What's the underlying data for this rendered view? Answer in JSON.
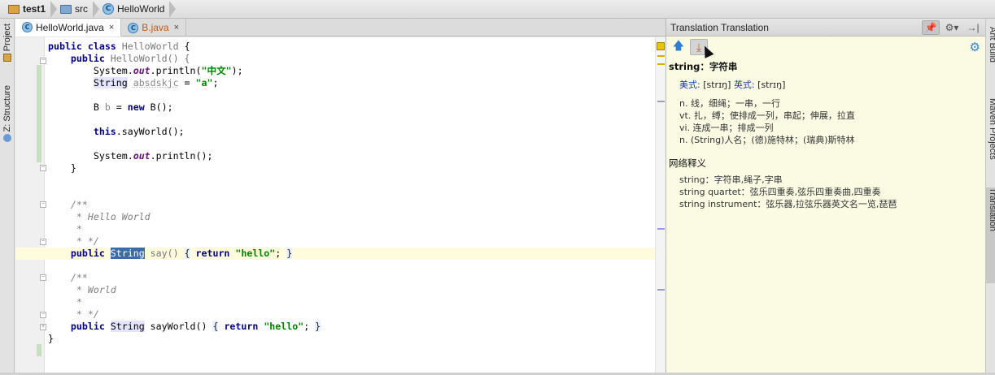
{
  "breadcrumb": {
    "project": "test1",
    "folder": "src",
    "file": "HelloWorld"
  },
  "left_tools": {
    "project": "1: Project",
    "structure": "Z: Structure",
    "project_short": "Project"
  },
  "tabs": [
    {
      "label": "HelloWorld.java",
      "close": "×"
    },
    {
      "label": "B.java",
      "close": "×"
    }
  ],
  "code": {
    "l1": [
      "public",
      "class",
      "HelloWorld",
      "{"
    ],
    "l2_kw": "public",
    "l2_name": "HelloWorld() {",
    "l3_a": "System.",
    "l3_b": "out",
    "l3_c": ".println(",
    "l3_d": "\"中文\"",
    "l3_e": ");",
    "l4_a": "String",
    "l4_b": "absdskjc",
    "l4_c": " = ",
    "l4_d": "\"a\"",
    "l4_e": ";",
    "l6_a": "B ",
    "l6_b": "b",
    "l6_c": " = ",
    "l6_d": "new",
    "l6_e": " B();",
    "l8_a": "this",
    "l8_b": ".sayWorld();",
    "l10_a": "System.",
    "l10_b": "out",
    "l10_c": ".println();",
    "l11": "}",
    "c1": "/**",
    "c2": " * Hello World",
    "c3": " *",
    "c4": " * */",
    "say_kw": "public",
    "say_type": "String",
    "say_name": "say()",
    "say_open": "{",
    "say_ret": "return",
    "say_str": "\"hello\"",
    "say_end": ";",
    "say_close": "}",
    "c5": "/**",
    "c6": " * World",
    "c7": " *",
    "c8": " * */",
    "sw_kw": "public",
    "sw_type": "String",
    "sw_name": "sayWorld()",
    "sw_open": "{",
    "sw_ret": "return",
    "sw_str": "\"hello\"",
    "sw_end": ";",
    "sw_close": "}",
    "last": "}"
  },
  "panel": {
    "title": "Translation Translation",
    "word": "string",
    "word_sep": "：",
    "word_zh": "字符串",
    "phon_us_label": "美式:",
    "phon_us": "[strɪŋ]",
    "phon_uk_label": "英式:",
    "phon_uk": "[strɪŋ]",
    "defs": [
      "n. 线，细绳；一串，一行",
      "vt. 扎，缚；使排成一列，串起；伸展，拉直",
      "vi. 连成一串；排成一列",
      "n. (String)人名；(德)施特林；(瑞典)斯特林"
    ],
    "net_title": "网络释义",
    "net": [
      "string：字符串,绳子,字串",
      "string quartet：弦乐四重奏,弦乐四重奏曲,四重奏",
      "string instrument：弦乐器,拉弦乐器英文名一览,琵琶"
    ]
  },
  "right_tools": {
    "ant": "Ant Build",
    "maven": "Maven Projects",
    "translation": "Translation"
  },
  "colors": {
    "panel_bg": "#fbfbe4",
    "selection": "#3c6ca3",
    "keyword": "#000080",
    "string": "#008000"
  }
}
